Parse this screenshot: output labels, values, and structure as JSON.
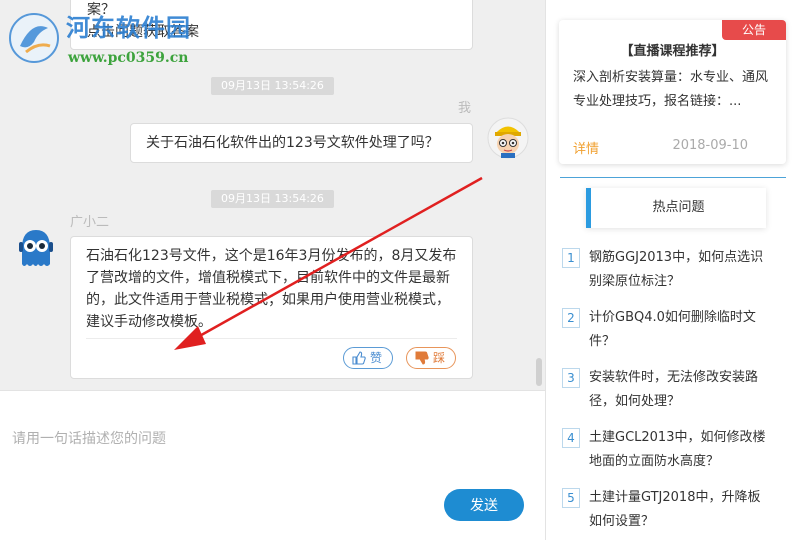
{
  "watermark": {
    "title": "河东软件园",
    "url": "www.pc0359.cn"
  },
  "chat": {
    "prev_message": {
      "line1": "案？",
      "line2": "点击问题获取答案"
    },
    "timestamp_1": "09月13日 13:54:26",
    "me_label": "我",
    "user_message": "关于石油石化软件出的123号文软件处理了吗？",
    "timestamp_2": "09月13日 13:54:26",
    "agent_name": "广小二",
    "agent_message": "石油石化123号文件，这个是16年3月份发布的，8月又发布了营改增的文件，增值税模式下，目前软件中的文件是最新的，此文件适用于营业税模式；如果用户使用营业税模式，建议手动修改模板。",
    "like_label": "赞",
    "dislike_label": "踩"
  },
  "input": {
    "placeholder": "请用一句话描述您的问题",
    "send_label": "发送"
  },
  "notice": {
    "badge": "公告",
    "title": "【直播课程推荐】",
    "body": "深入剖析安装算量：水专业、通风专业处理技巧，报名链接：...",
    "detail": "详情",
    "date": "2018-09-10"
  },
  "hot": {
    "header": "热点问题",
    "items": [
      {
        "num": "1",
        "text": "钢筋GGJ2013中，如何点选识别梁原位标注？"
      },
      {
        "num": "2",
        "text": "计价GBQ4.0如何删除临时文件？"
      },
      {
        "num": "3",
        "text": "安装软件时，无法修改安装路径，如何处理？"
      },
      {
        "num": "4",
        "text": "土建GCL2013中，如何修改楼地面的立面防水高度？"
      },
      {
        "num": "5",
        "text": "土建计量GTJ2018中，升降板如何设置？"
      }
    ]
  },
  "colors": {
    "accent": "#1e8cd2",
    "badge": "#e74b4b",
    "detail": "#f0a030",
    "arrow": "#e02020"
  }
}
